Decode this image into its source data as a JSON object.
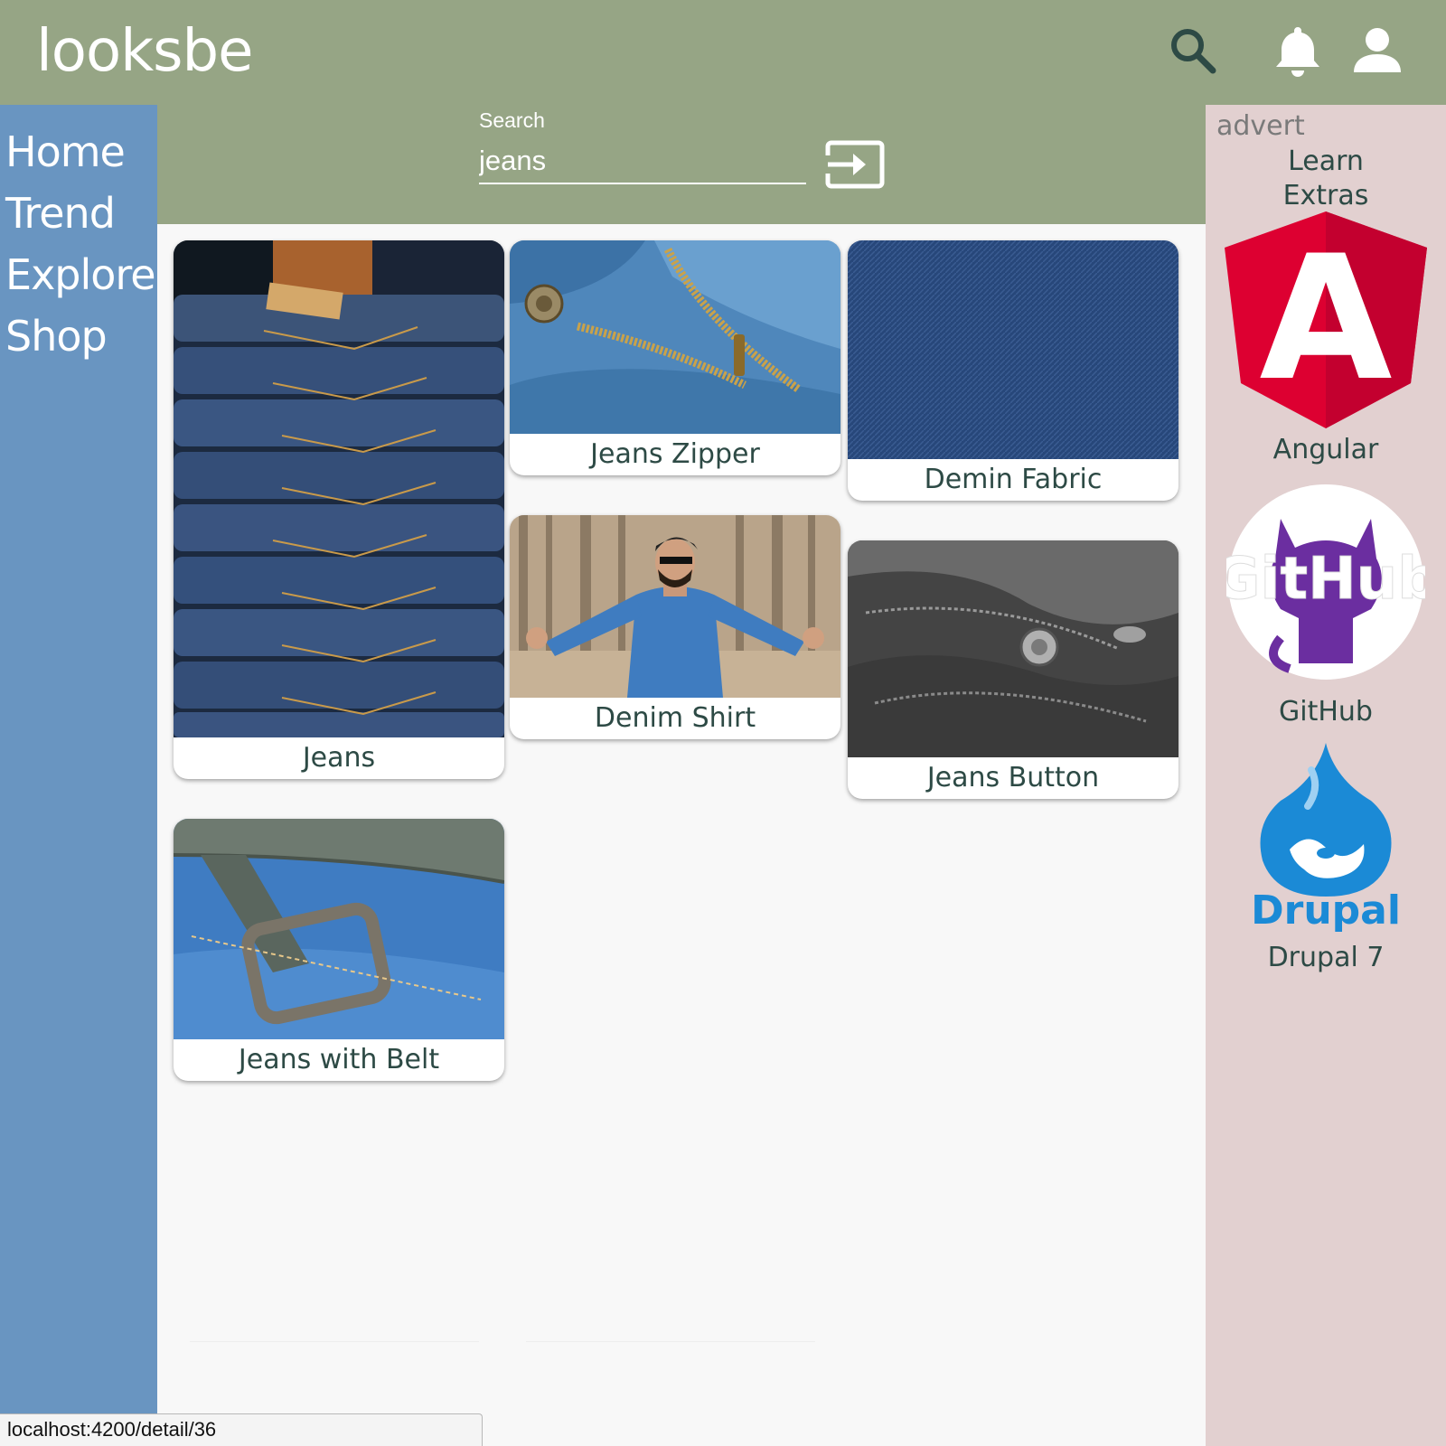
{
  "app": {
    "brand": "looksbe"
  },
  "header": {
    "icons": [
      "search-icon",
      "bell-icon",
      "account-icon"
    ]
  },
  "sidebar": {
    "items": [
      {
        "label": "Home"
      },
      {
        "label": "Trend"
      },
      {
        "label": "Explore"
      },
      {
        "label": "Shop"
      }
    ]
  },
  "search": {
    "label": "Search",
    "value": "jeans",
    "submit_icon": "login-arrow-icon"
  },
  "results": [
    {
      "title": "Jeans"
    },
    {
      "title": "Jeans Zipper"
    },
    {
      "title": "Demin Fabric"
    },
    {
      "title": "Denim Shirt"
    },
    {
      "title": "Jeans Button"
    },
    {
      "title": "Jeans with Belt"
    }
  ],
  "advert": {
    "label": "advert",
    "title_line1": "Learn",
    "title_line2": "Extras",
    "items": [
      {
        "name": "Angular",
        "logo": "angular-logo",
        "logo_text": "A"
      },
      {
        "name": "GitHub",
        "logo": "github-logo",
        "logo_text": "GitHub"
      },
      {
        "name": "Drupal 7",
        "logo": "drupal-logo",
        "logo_text": "Drupal"
      }
    ]
  },
  "status": {
    "url": "localhost:4200/detail/36"
  },
  "colors": {
    "header_bg": "#96a585",
    "sidebar_bg": "#6995c1",
    "advert_bg": "#e2d0d0",
    "card_text": "#2d4a45",
    "icon_color": "#2d4a45"
  }
}
